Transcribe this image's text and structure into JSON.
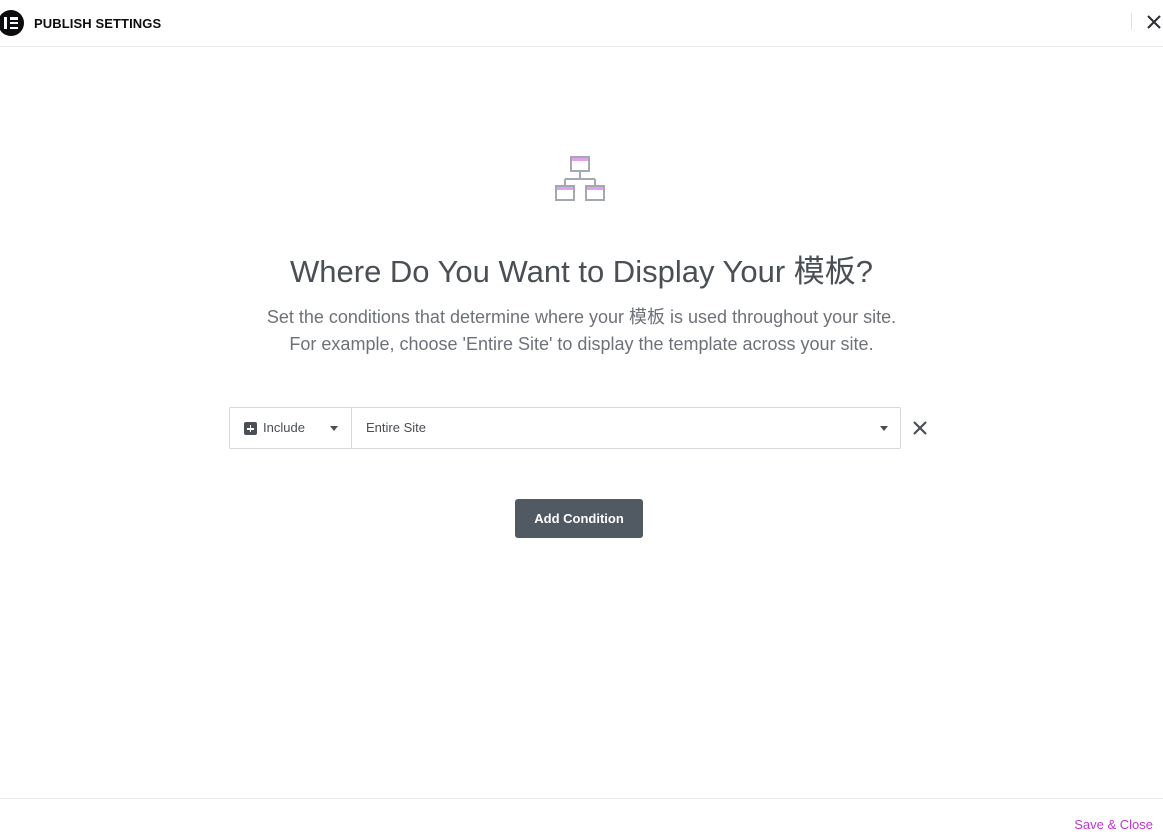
{
  "header": {
    "title": "PUBLISH SETTINGS",
    "logo_icon": "elementor-logo-icon",
    "close_icon": "close-icon"
  },
  "intro": {
    "icon": "site-hierarchy-icon",
    "title": "Where Do You Want to Display Your 模板?",
    "description_line1": "Set the conditions that determine where your 模板 is used throughout your site.",
    "description_line2": "For example, choose 'Entire Site' to display the template across your site."
  },
  "conditions": [
    {
      "type_icon": "plus-square-icon",
      "type_label": "Include",
      "name_label": "Entire Site",
      "remove_icon": "close-icon"
    }
  ],
  "add_condition_label": "Add Condition",
  "footer": {
    "save_close_label": "Save & Close"
  },
  "colors": {
    "accent": "#c036d3",
    "button_bg": "#515962",
    "text_primary": "#4a4f55",
    "icon_pink": "#e2a0f0",
    "icon_gray": "#a4a9b0"
  }
}
